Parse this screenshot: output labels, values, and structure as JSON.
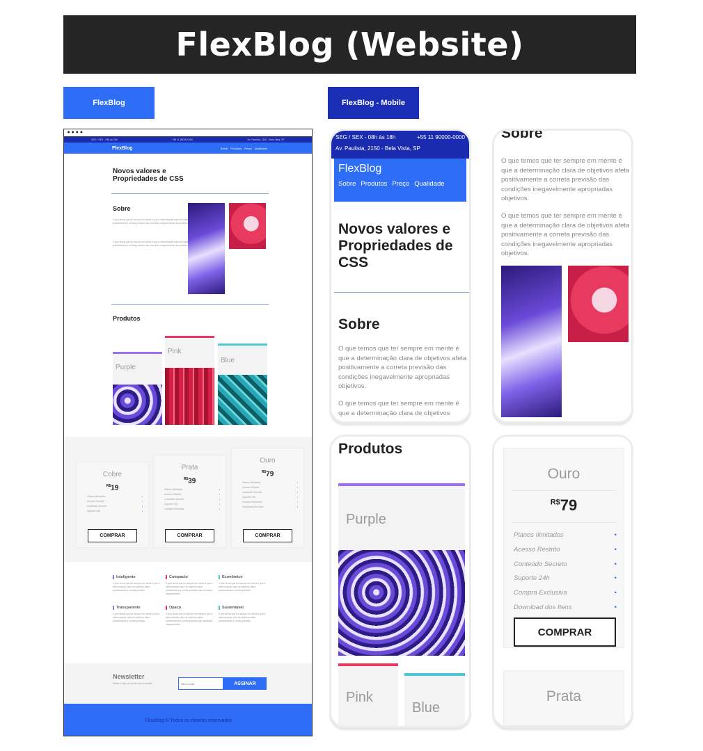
{
  "header": {
    "title": "FlexBlog (Website)"
  },
  "labels": {
    "desktop": "FlexBlog",
    "mobile": "FlexBlog - Mobile"
  },
  "desktop": {
    "window_dots": "••••",
    "topbar": {
      "hours": "SEG / SEX - 08h às 18h",
      "phone": "+55 11 90000-0000",
      "address": "Av. Paulista, 2150 - Bela Vista, SP"
    },
    "nav": {
      "logo": "FlexBlog",
      "links": [
        "Sobre",
        "Produtos",
        "Preço",
        "Qualidade"
      ]
    },
    "hero_title": "Novos valores e Propriedades de CSS",
    "sobre": {
      "title": "Sobre",
      "p1": "O que temos que ter sempre em mente é que a determinação clara de objetivos afeta positivamente a correta previsão das condições inegavelmente apropriadas objetivos.",
      "p2": "O que temos que ter sempre em mente é que a determinação clara de objetivos afeta positivamente a correta previsão das condições inegavelmente apropriadas objetivos."
    },
    "produtos": {
      "title": "Produtos",
      "items": [
        "Purple",
        "Pink",
        "Blue"
      ]
    },
    "plans": [
      {
        "name": "Cobre",
        "currency": "R$",
        "price": "19",
        "features": [
          "Planos Ilimitados",
          "Acesso Restrito",
          "Conteúdo Secreto",
          "Suporte 24h"
        ],
        "button": "COMPRAR"
      },
      {
        "name": "Prata",
        "currency": "R$",
        "price": "39",
        "features": [
          "Planos Ilimitados",
          "Acesso Restrito",
          "Conteúdo Secreto",
          "Suporte 24h",
          "Compra Exclusiva"
        ],
        "button": "COMPRAR"
      },
      {
        "name": "Ouro",
        "currency": "R$",
        "price": "79",
        "features": [
          "Planos Ilimitados",
          "Acesso Restrito",
          "Conteúdo Secreto",
          "Suporte 24h",
          "Compra Exclusiva",
          "Download dos Itens"
        ],
        "button": "COMPRAR"
      }
    ],
    "qualities": [
      {
        "title": "Inteligente",
        "color": "#9b6ef3",
        "text": "O que temos que ter sempre em mente é que a determinação clara de objetivos afeta positivamente a correta previsão."
      },
      {
        "title": "Compacto",
        "color": "#e8395f",
        "text": "O que temos que ter sempre em mente é que a determinação clara de objetivos afeta positivamente a correta previsão das condições inegavelmente."
      },
      {
        "title": "Econômico",
        "color": "#4cc7d6",
        "text": "O que temos que ter sempre em mente é que a determinação clara de objetivos afeta positivamente a correta previsão."
      },
      {
        "title": "Transparente",
        "color": "#9b6ef3",
        "text": "O que temos que ter sempre em mente é que a determinação clara de objetivos afeta positivamente a correta previsão."
      },
      {
        "title": "Opaco",
        "color": "#e8395f",
        "text": "O que temos que ter sempre em mente é que a determinação clara de objetivos afeta positivamente a correta previsão das condições inegavelmente."
      },
      {
        "title": "Sustentável",
        "color": "#4cc7d6",
        "text": "O que temos que ter sempre em mente é que a determinação clara de objetivos afeta positivamente a correta previsão."
      }
    ],
    "newsletter": {
      "title": "Newsletter",
      "subtitle": "Assine e fique por dentro das novidades",
      "placeholder": "Seu e-mail",
      "button": "ASSINAR"
    },
    "footer": "FlexBlog © Todos os direitos reservados"
  },
  "mobile": {
    "topbar": {
      "hours": "SEG / SEX - 08h às 18h",
      "phone": "+55 11 90000-0000",
      "address": "Av. Paulista, 2150 - Bela Vista, SP"
    },
    "logo": "FlexBlog",
    "links": [
      "Sobre",
      "Produtos",
      "Preço",
      "Qualidade"
    ],
    "hero_title": "Novos valores e Propriedades de CSS",
    "sobre_title": "Sobre",
    "sobre_p1": "O que temos que ter sempre em mente é que a determinação clara de objetivos afeta positivamente a correta previsão das condições inegavelmente apropriadas objetivos.",
    "sobre_p2_partial": "O que temos que ter sempre em mente é que a determinação clara de objetivos",
    "produtos_title": "Produtos",
    "products": [
      "Purple",
      "Pink",
      "Blue"
    ],
    "plan": {
      "name": "Ouro",
      "currency": "R$",
      "price": "79",
      "features": [
        "Planos Ilimitados",
        "Acesso Restrito",
        "Conteúdo Secreto",
        "Suporte 24h",
        "Compra Exclusiva",
        "Download dos Itens"
      ],
      "button": "COMPRAR"
    },
    "plan_next": "Prata"
  },
  "colors": {
    "brand_blue": "#2e6df5",
    "dark_blue": "#1a2bb0",
    "purple": "#9b6ef3",
    "pink": "#e8395f",
    "teal": "#4cc7d6"
  }
}
